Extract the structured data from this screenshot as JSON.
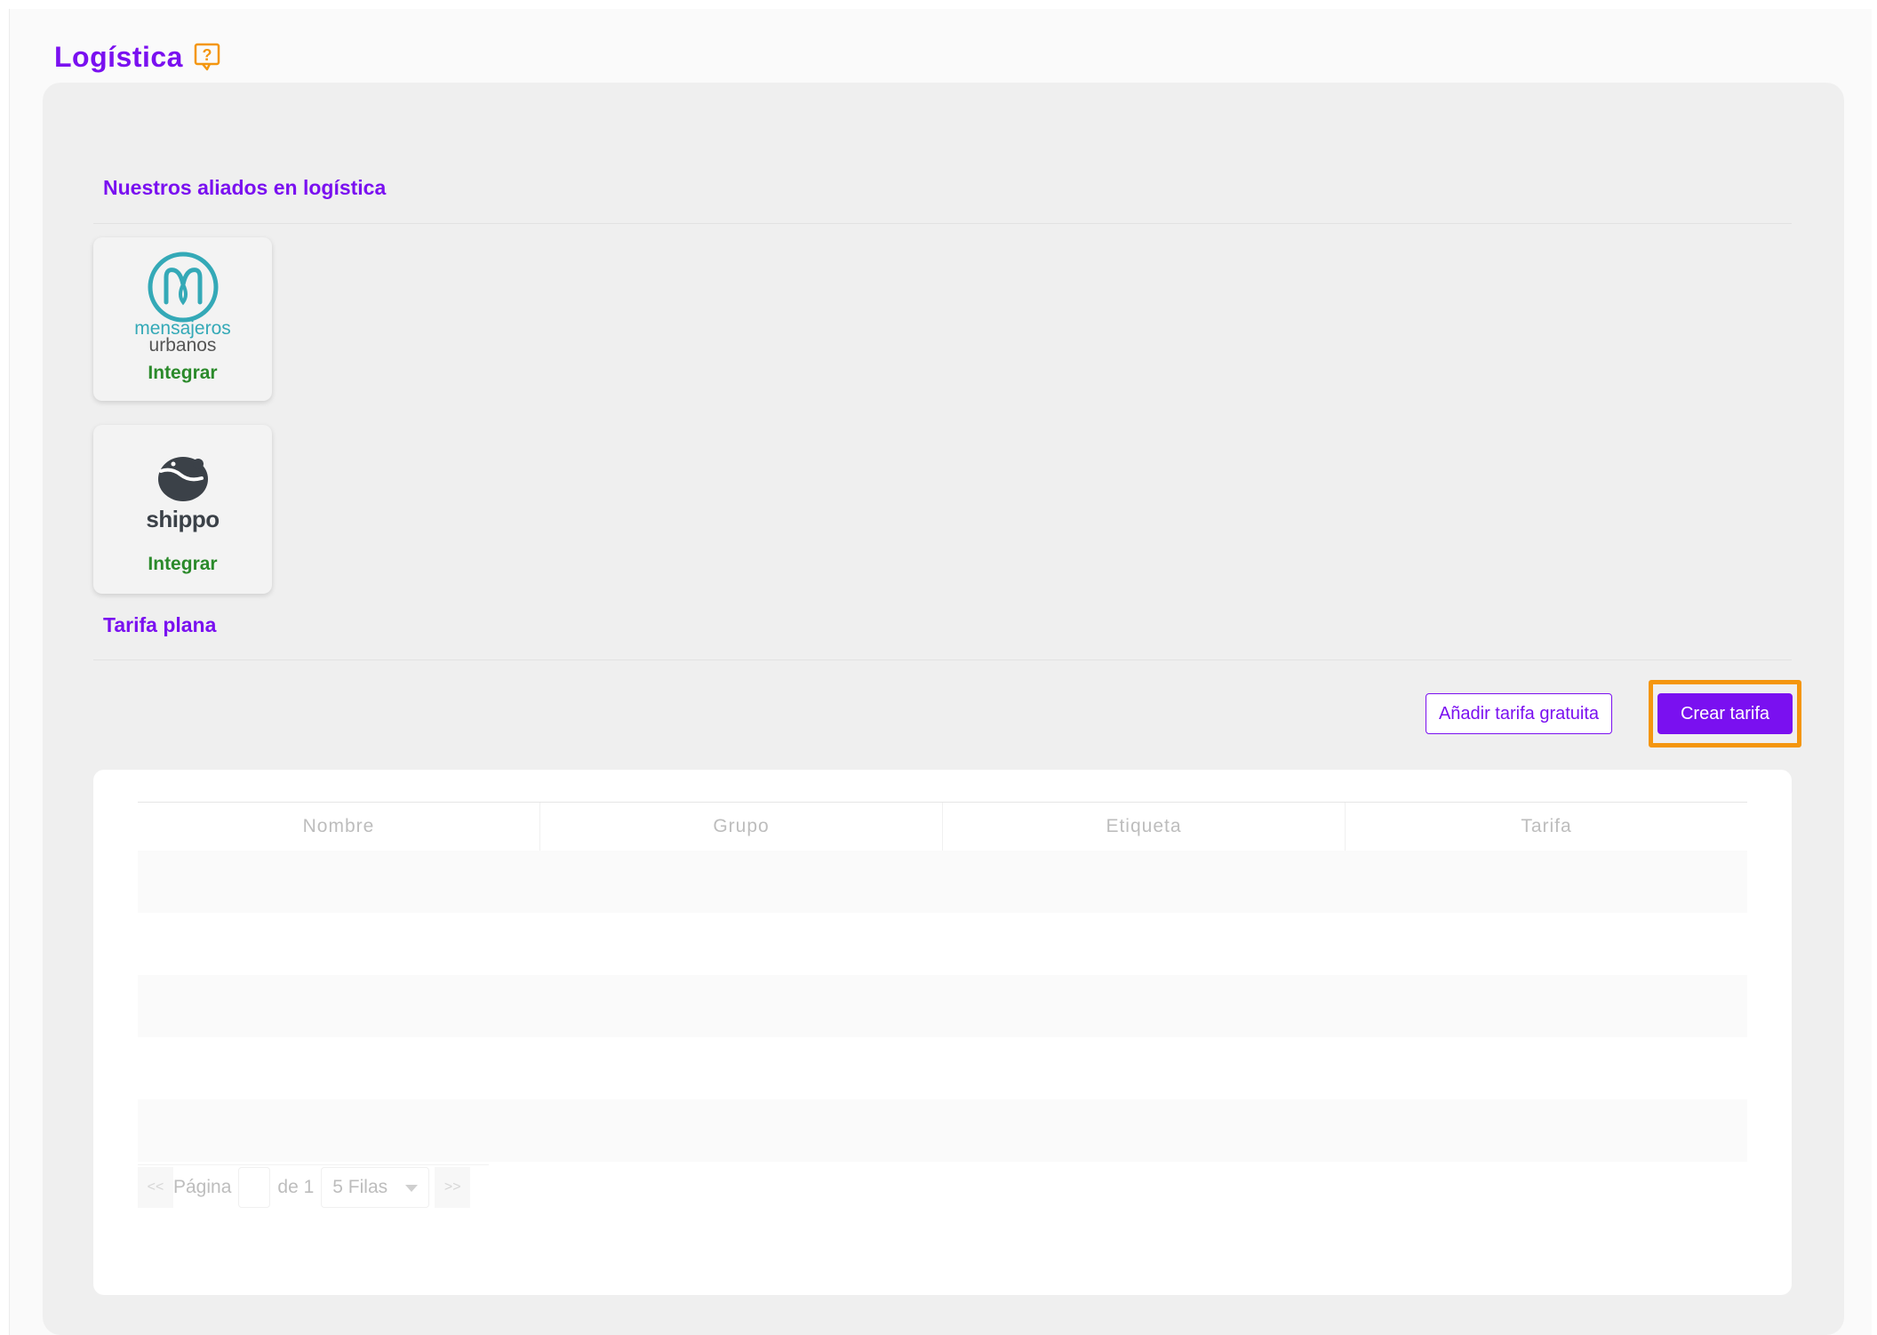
{
  "header": {
    "title": "Logística",
    "help_icon": "help-question-icon"
  },
  "partners": {
    "title": "Nuestros aliados en logística",
    "items": [
      {
        "logo_line1": "mensajeros",
        "logo_line2": "urbanos",
        "action": "Integrar"
      },
      {
        "logo_text": "shippo",
        "action": "Integrar"
      }
    ]
  },
  "flat_rate": {
    "title": "Tarifa plana",
    "add_free_label": "Añadir tarifa gratuita",
    "create_label": "Crear tarifa"
  },
  "table": {
    "columns": [
      "Nombre",
      "Grupo",
      "Etiqueta",
      "Tarifa"
    ],
    "rows": []
  },
  "pagination": {
    "prev": "<<",
    "page_label": "Página",
    "page_value": "",
    "of_label": "de 1",
    "rows_select": "5 Filas",
    "next": ">>"
  },
  "colors": {
    "brand": "#7a10f0",
    "integrate": "#2b8a2b",
    "highlight": "#f4960e"
  }
}
